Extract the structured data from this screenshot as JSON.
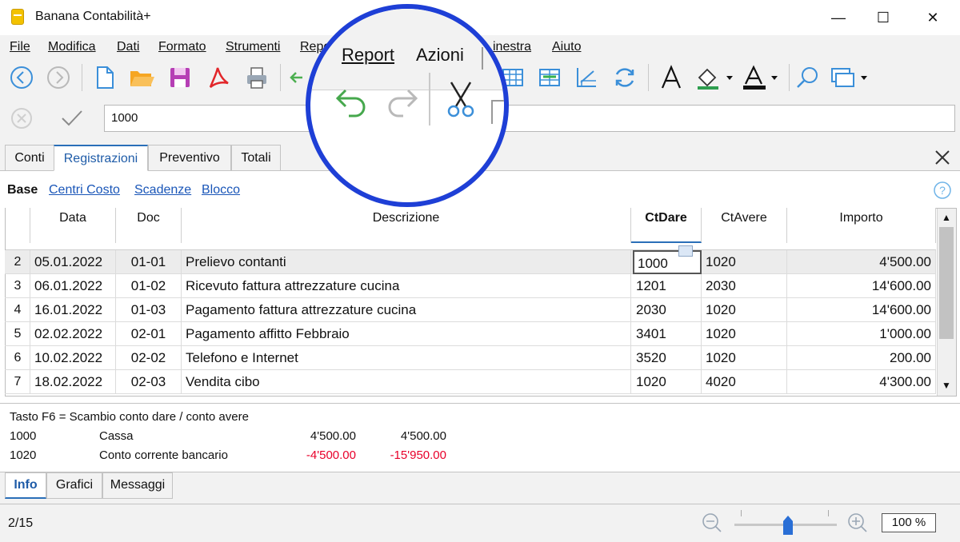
{
  "window": {
    "title": "Banana Contabilità+",
    "minimize_glyph": "—",
    "maximize_glyph": "☐",
    "close_glyph": "✕"
  },
  "menu": {
    "items": [
      {
        "label": "File",
        "ul": "F"
      },
      {
        "label": "Modifica",
        "ul": "M"
      },
      {
        "label": "Dati",
        "ul": "D"
      },
      {
        "label": "Formato",
        "ul": "o"
      },
      {
        "label": "Strumenti",
        "ul": "S"
      },
      {
        "label": "Repo",
        "ul": ""
      },
      {
        "label": "inestra",
        "ul": "F"
      },
      {
        "label": "Aiuto",
        "ul": "A"
      }
    ]
  },
  "toolbar": {
    "icons": [
      "back-icon",
      "forward-icon",
      "new-file-icon",
      "open-folder-icon",
      "save-icon",
      "pdf-icon",
      "print-icon",
      "insert-rows-icon",
      "table-icon",
      "table-columns-icon",
      "chart-icon",
      "refresh-icon",
      "font-icon",
      "fill-color-icon",
      "text-color-icon",
      "search-icon",
      "window-icon"
    ]
  },
  "edit_row": {
    "value": "1000"
  },
  "tabs": [
    "Conti",
    "Registrazioni",
    "Preventivo",
    "Totali"
  ],
  "active_tab": "Registrazioni",
  "views": {
    "base": "Base",
    "links": [
      "Centri Costo",
      "Scadenze",
      "Blocco"
    ]
  },
  "table": {
    "columns": [
      "Data",
      "Doc",
      "Descrizione",
      "CtDare",
      "CtAvere",
      "Importo"
    ],
    "rows": [
      {
        "n": "2",
        "data": "05.01.2022",
        "doc": "01-01",
        "desc": "Prelievo contanti",
        "dare": "1000",
        "avere": "1020",
        "importo": "4'500.00"
      },
      {
        "n": "3",
        "data": "06.01.2022",
        "doc": "01-02",
        "desc": "Ricevuto fattura attrezzature cucina",
        "dare": "1201",
        "avere": "2030",
        "importo": "14'600.00"
      },
      {
        "n": "4",
        "data": "16.01.2022",
        "doc": "01-03",
        "desc": "Pagamento fattura attrezzature cucina",
        "dare": "2030",
        "avere": "1020",
        "importo": "14'600.00"
      },
      {
        "n": "5",
        "data": "02.02.2022",
        "doc": "02-01",
        "desc": "Pagamento affitto Febbraio",
        "dare": "3401",
        "avere": "1020",
        "importo": "1'000.00"
      },
      {
        "n": "6",
        "data": "10.02.2022",
        "doc": "02-02",
        "desc": "Telefono e Internet",
        "dare": "3520",
        "avere": "1020",
        "importo": "200.00"
      },
      {
        "n": "7",
        "data": "18.02.2022",
        "doc": "02-03",
        "desc": "Vendita cibo",
        "dare": "1020",
        "avere": "4020",
        "importo": "4'300.00"
      }
    ]
  },
  "info": {
    "hint": "Tasto F6 = Scambio conto dare / conto avere",
    "lines": [
      {
        "account": "1000",
        "name": "Cassa",
        "amount": "4'500.00",
        "balance": "4'500.00",
        "negative": false
      },
      {
        "account": "1020",
        "name": "Conto corrente bancario",
        "amount": "-4'500.00",
        "balance": "-15'950.00",
        "negative": true
      }
    ]
  },
  "bottom_tabs": [
    "Info",
    "Grafici",
    "Messaggi"
  ],
  "status": {
    "position": "2/15",
    "zoom": "100 %",
    "zoom_fraction": 0.5
  },
  "overlay": {
    "menu": [
      "Report",
      "Azioni"
    ],
    "icons": [
      "undo-icon",
      "redo-icon",
      "cut-icon"
    ]
  },
  "colors": {
    "accent": "#1f5ca8",
    "negative": "#e8002a",
    "overlay_ring": "#1e3fd6"
  }
}
